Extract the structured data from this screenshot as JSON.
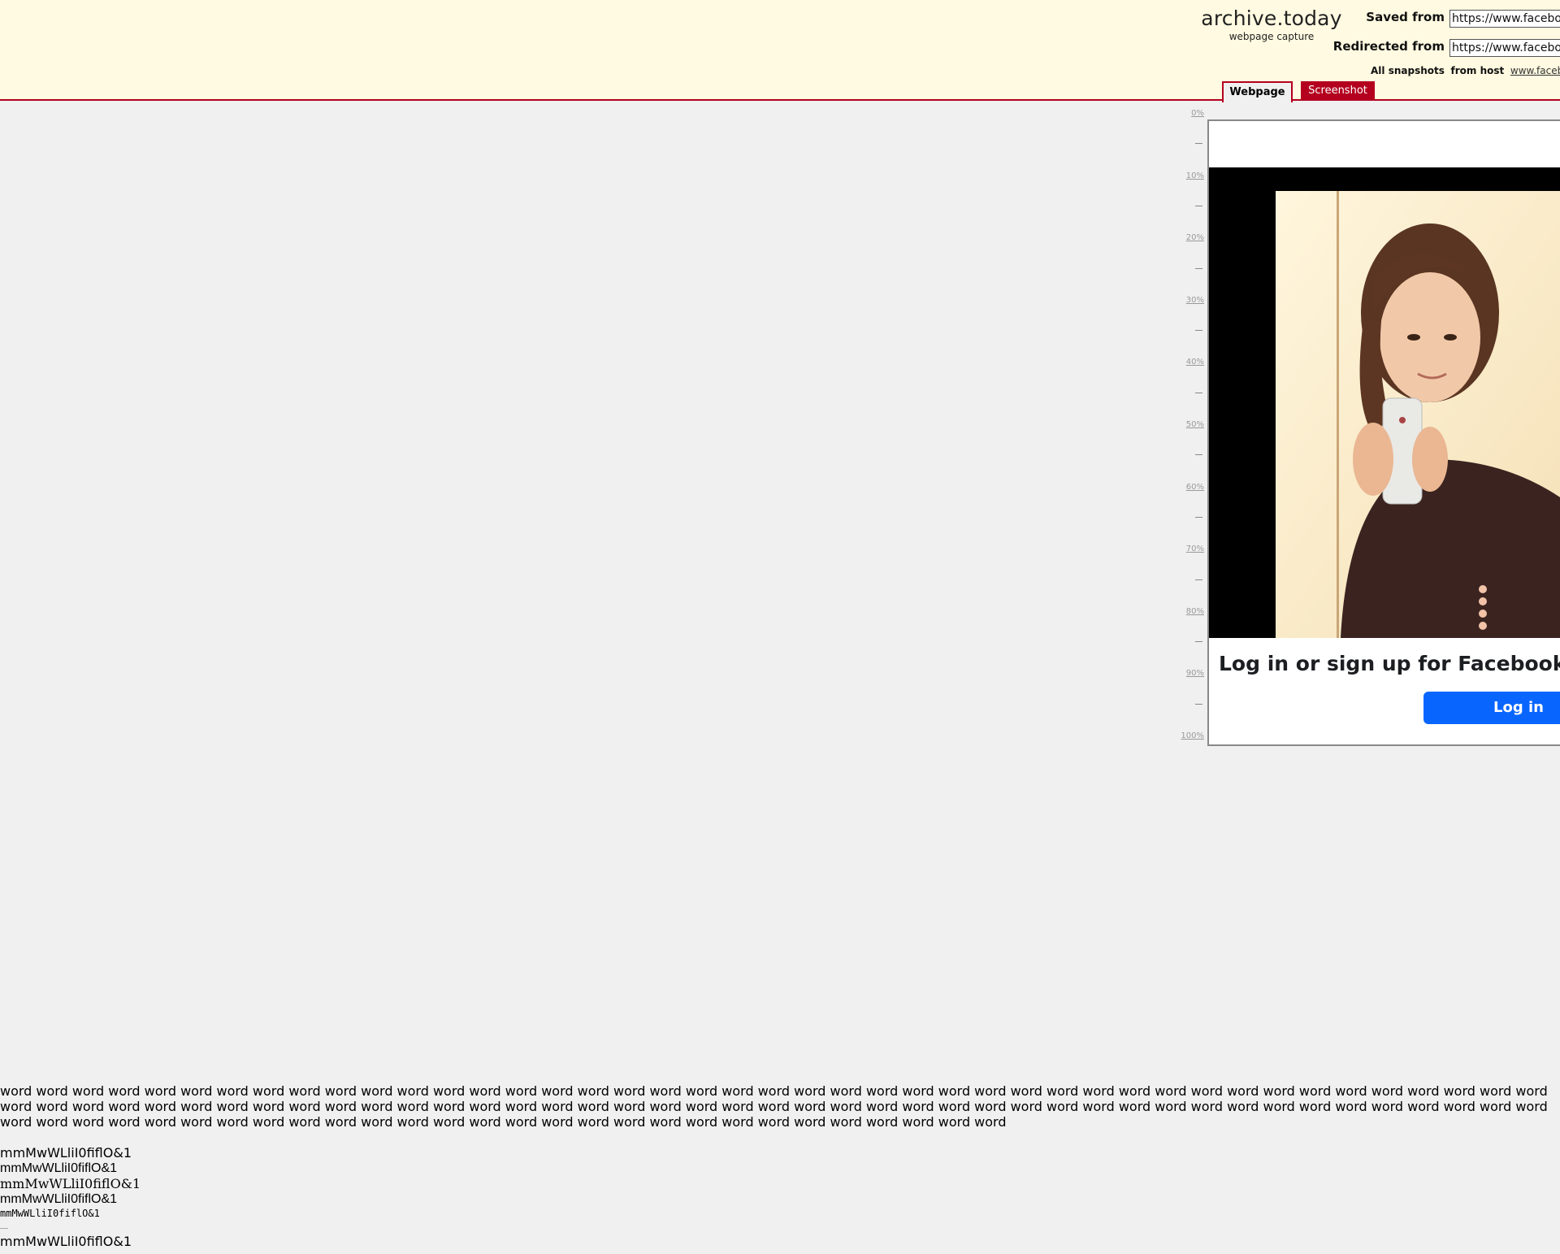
{
  "header": {
    "site_name": "archive.today",
    "site_sub": "webpage capture",
    "saved_from_label": "Saved from",
    "saved_from_value": "https://www.facebook.com/",
    "redirected_from_label": "Redirected from",
    "redirected_from_value": "https://www.facebook.com/",
    "all_snapshots_label": "All snapshots",
    "from_host_label": "from host",
    "host_link": "www.facebook.com"
  },
  "tabs": {
    "webpage": "Webpage",
    "screenshot": "Screenshot"
  },
  "ruler": {
    "labels": [
      "0%",
      "10%",
      "20%",
      "30%",
      "40%",
      "50%",
      "60%",
      "70%",
      "80%",
      "90%",
      "100%"
    ]
  },
  "page": {
    "login_title": "Log in or sign up for Facebook",
    "login_button": "Log in"
  },
  "test_text": {
    "words": "word word word word word word word word word word word word word word word word word word word word word word word word word word word word word word word word word word word word word word word word word word word word word word word word word word word word word word word word word word word word word word word word word word word word word word word word word word word word word word word word word word word word word word word word word word word word word word word word word word word word word word word word word word word word word word word word word word",
    "line1": "mmMwWLliI0fiflO&1",
    "line2": "mmMwWLliI0fiflO&1",
    "line3": "mmMwWLliI0fiflO&1",
    "line4": "mmMwWLliI0fiflO&1",
    "line5": "mmMwWLliI0fiflO&1",
    "line6": "mmMwWLliI0fiflO&1"
  },
  "colors": {
    "header_bg": "#fffae1",
    "accent": "#b4001e",
    "fb_blue": "#0866ff",
    "page_bg": "#f0f0f0"
  }
}
